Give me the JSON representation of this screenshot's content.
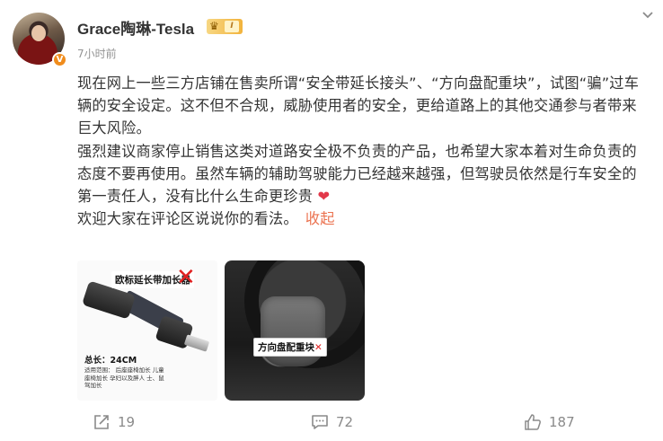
{
  "author": {
    "name": "Grace陶琳-Tesla",
    "level": "I",
    "verified_badge": "V",
    "time": "7小时前"
  },
  "post": {
    "paragraphs": [
      "现在网上一些三方店铺在售卖所谓“安全带延长接头”、“方向盘配重块”，试图“骗”过车辆的安全设定。这不但不合规，威胁使用者的安全，更给道路上的其他交通参与者带来巨大风险。",
      "强烈建议商家停止销售这类对道路安全极不负责的产品，也希望大家本着对生命负责的态度不要再使用。虽然车辆的辅助驾驶能力已经越来越强，但驾驶员依然是行车安全的第一责任人，没有比什么生命更珍贵",
      "欢迎大家在评论区说说你的看法。"
    ],
    "heart_emoji": "❤",
    "collapse_label": "收起"
  },
  "images": {
    "left": {
      "tag": "欧标延长带加长器",
      "length": "总长：24CM",
      "usage": "适用范围：  后座座椅加长 儿童座椅加长 孕妇以及胖人 士、鼠驾加长"
    },
    "right": {
      "tag": "方向盘配重块",
      "x": "✕"
    }
  },
  "actions": {
    "repost_count": "19",
    "comment_count": "72",
    "like_count": "187"
  },
  "icons": {
    "more": "chevron-down-icon",
    "repost": "repost-icon",
    "comment": "comment-icon",
    "like": "thumbs-up-icon"
  },
  "colors": {
    "link": "#eb7350",
    "heart": "#e2384a",
    "verified": "#f08c1c",
    "muted": "#8a8a8a"
  }
}
